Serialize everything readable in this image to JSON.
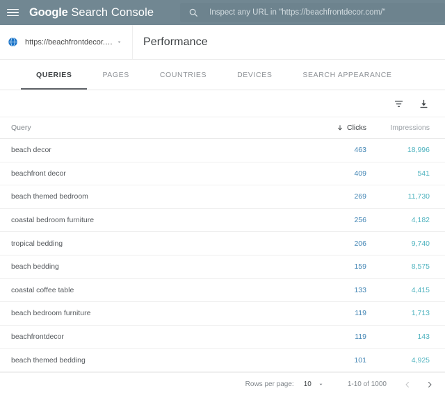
{
  "header": {
    "menu_icon": "hamburger-icon",
    "brand_bold": "Google",
    "brand_light": " Search Console",
    "search": {
      "icon": "search-icon",
      "placeholder": "Inspect any URL in \"https://beachfrontdecor.com/\""
    },
    "colors": {
      "topbar_bg": "#718792",
      "search_bg": "#6d838e"
    }
  },
  "property": {
    "icon": "globe-property-icon",
    "url": "https://beachfrontdecor.com/",
    "caret_icon": "chevron-down-icon"
  },
  "page": {
    "title": "Performance"
  },
  "tabs": [
    {
      "label": "QUERIES",
      "active": true
    },
    {
      "label": "PAGES",
      "active": false
    },
    {
      "label": "COUNTRIES",
      "active": false
    },
    {
      "label": "DEVICES",
      "active": false
    },
    {
      "label": "SEARCH APPEARANCE",
      "active": false
    }
  ],
  "toolbar": {
    "filter_icon": "filter-icon",
    "download_icon": "download-icon"
  },
  "table": {
    "columns": {
      "query": "Query",
      "clicks": "Clicks",
      "impressions": "Impressions"
    },
    "sort": {
      "column": "clicks",
      "direction": "desc",
      "arrow_icon": "arrow-down-icon"
    },
    "rows": [
      {
        "query": "beach decor",
        "clicks": "463",
        "impressions": "18,996"
      },
      {
        "query": "beachfront decor",
        "clicks": "409",
        "impressions": "541"
      },
      {
        "query": "beach themed bedroom",
        "clicks": "269",
        "impressions": "11,730"
      },
      {
        "query": "coastal bedroom furniture",
        "clicks": "256",
        "impressions": "4,182"
      },
      {
        "query": "tropical bedding",
        "clicks": "206",
        "impressions": "9,740"
      },
      {
        "query": "beach bedding",
        "clicks": "159",
        "impressions": "8,575"
      },
      {
        "query": "coastal coffee table",
        "clicks": "133",
        "impressions": "4,415"
      },
      {
        "query": "beach bedroom furniture",
        "clicks": "119",
        "impressions": "1,713"
      },
      {
        "query": "beachfrontdecor",
        "clicks": "119",
        "impressions": "143"
      },
      {
        "query": "beach themed bedding",
        "clicks": "101",
        "impressions": "4,925"
      }
    ],
    "colors": {
      "clicks_value": "#4285b4",
      "impressions_value": "#4fb3bf"
    }
  },
  "pagination": {
    "rows_per_page_label": "Rows per page:",
    "rows_per_page_value": "10",
    "rows_per_page_caret": "chevron-down-icon",
    "range": "1-10 of 1000",
    "prev_icon": "chevron-left-icon",
    "next_icon": "chevron-right-icon"
  }
}
